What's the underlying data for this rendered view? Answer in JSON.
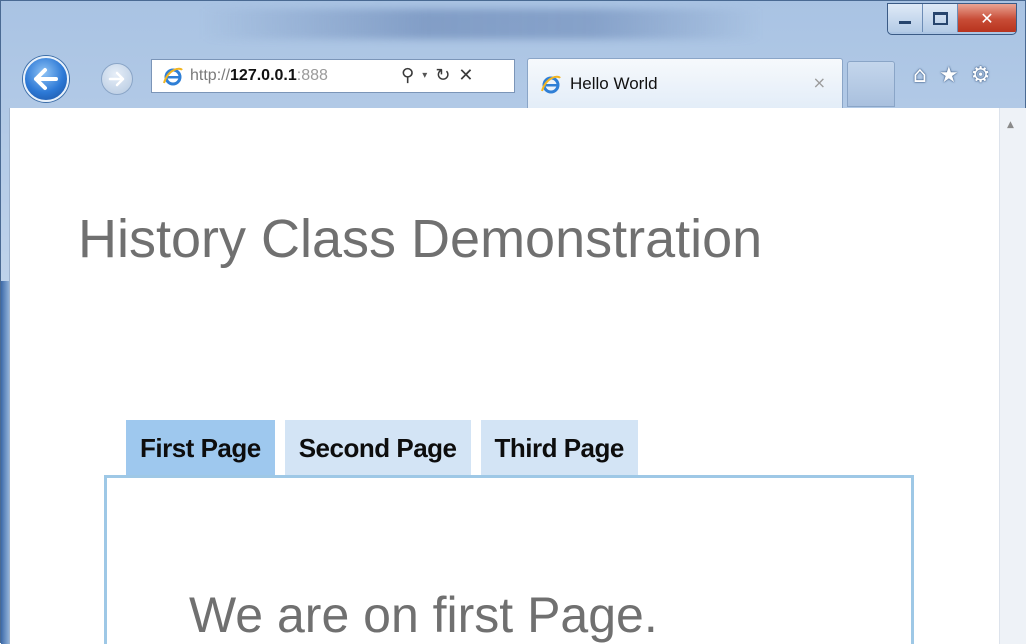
{
  "browser": {
    "address": {
      "scheme": "http://",
      "host": "127.0.0.1",
      "port": ":888"
    },
    "tab": {
      "title": "Hello World",
      "close": "×"
    },
    "icons": {
      "back": "back-arrow-icon",
      "forward": "forward-arrow-icon",
      "search": "⚲",
      "dropdown": "▾",
      "refresh": "↻",
      "stop": "✕",
      "home": "⌂",
      "favorites": "★",
      "tools": "⚙"
    },
    "window_controls": {
      "close": "✕"
    }
  },
  "page": {
    "heading": "History Class Demonstration",
    "tabs": [
      {
        "label": "First Page",
        "active": true
      },
      {
        "label": "Second Page",
        "active": false
      },
      {
        "label": "Third Page",
        "active": false
      }
    ],
    "panel_text": "We are on first Page."
  },
  "colors": {
    "active_tab": "#9ec8ee",
    "inactive_tab": "#d3e4f5",
    "panel_border": "#9ec8e6",
    "heading_text": "#707070"
  }
}
